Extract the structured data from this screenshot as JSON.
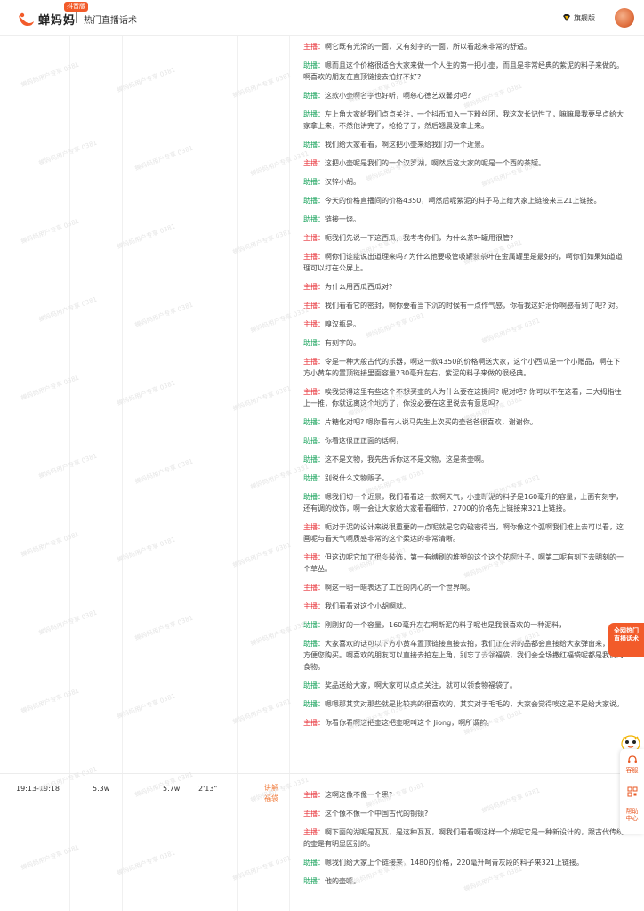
{
  "header": {
    "brand": "蝉妈妈",
    "version_badge": "抖音版",
    "page_title": "热门直播话术",
    "account_label": "旗舰版"
  },
  "colors": {
    "brand": "#f25b2a",
    "host_role": "#e8333a",
    "assistant_role": "#19a35c",
    "type_tag": "#f07a3a"
  },
  "watermark_text": "蝉妈妈用户专享 0381",
  "row_second": {
    "time_range": "19:13-19:18",
    "metric_a": "5.3w",
    "metric_b": "5.7w",
    "duration": "2'13\"",
    "type": "讲解\n福袋"
  },
  "lines_first": [
    {
      "role": "主播：",
      "kind": "host",
      "text": "啊它既有光滑的一面，又有刻字的一面，所以看起来非常的舒适。"
    },
    {
      "role": "助播：",
      "kind": "assist",
      "text": "嗯而且这个价格很适合大家来做一个人生的第一把小壶，而且是非常经典的紫泥的料子来做的。啊喜欢的朋友在直顶链接去拍好不好?"
    },
    {
      "role": "助播：",
      "kind": "assist",
      "text": "这款小壶啊名字也好听，啊慈心德艺双馨对吧?"
    },
    {
      "role": "助播：",
      "kind": "assist",
      "text": "左上角大家给我们点点关注，一个抖币加入一下粉丝团，我这次长记性了，嘛嘛晨我要早点给大家拿上来，不然他讲完了，抢抢了了，然后翘晨没拿上来。"
    },
    {
      "role": "助播：",
      "kind": "assist",
      "text": "我们给大家看看，啊这把小壶来给我们切一个近景。"
    },
    {
      "role": "主播：",
      "kind": "host",
      "text": "这把小壶呢是我们的一个汉罗湖，啊然后这大家的呢是一个西的茶罐。"
    },
    {
      "role": "助播：",
      "kind": "assist",
      "text": "汉锌小胡。"
    },
    {
      "role": "助播：",
      "kind": "assist",
      "text": "今天的价格直播间的价格4350，啊然后呢紫泥的料子马上给大家上链接来三21上链接。"
    },
    {
      "role": "助播：",
      "kind": "assist",
      "text": "链接一烧。"
    },
    {
      "role": "主播：",
      "kind": "host",
      "text": "呃我们先说一下这西瓜，我考考你们，为什么茶叶罐用很管?"
    },
    {
      "role": "主播：",
      "kind": "host",
      "text": "啊你们谁能说出道理来吗? 为什么他要吸管吸罐装茶叶在金属罐里是最好的，啊你们如果知道道理可以打在公屏上。"
    },
    {
      "role": "主播：",
      "kind": "host",
      "text": "为什么用西瓜西瓜对?"
    },
    {
      "role": "主播：",
      "kind": "host",
      "text": "我们看看它的密封，啊你要看当下沉的时候有一点作气感，你看我这好治你啊感看到了吧? 对。"
    },
    {
      "role": "主播：",
      "kind": "host",
      "text": "嗅汉瓶是。"
    },
    {
      "role": "助播：",
      "kind": "assist",
      "text": "有刻字的。"
    },
    {
      "role": "主播：",
      "kind": "host",
      "text": "令是一种大般古代的乐器，啊这一款4350的价格啊送大家，这个小西瓜是一个小赠品，啊在下方小黄车的置顶链接里面容量230毫升左右，紫泥的料子来做的很经典。"
    },
    {
      "role": "主播：",
      "kind": "host",
      "text": "唉我觉得这里有些这个不想买壶的人为什么要在这提问? 呢对吧? 你可以不在这看，二大拇指往上一推，你就远离这个地方了，你没必要在这里说去有意思吗?"
    },
    {
      "role": "助播：",
      "kind": "assist",
      "text": "片糖化对吧? 嗯你看有人说马先生上次买的壶爸爸很喜欢，谢谢你。"
    },
    {
      "role": "助播：",
      "kind": "assist",
      "text": "你看这很正正面的话啊，"
    },
    {
      "role": "助播：",
      "kind": "assist",
      "text": "这不是文物，我先告诉你这不是文物，这是茶壶啊。"
    },
    {
      "role": "助播：",
      "kind": "assist",
      "text": "别说什么文物贩子。"
    },
    {
      "role": "助播：",
      "kind": "assist",
      "text": "嗯我们切一个近景，我们看看这一款啊天气，小壶断泥的料子是160毫升的容量，上面有刻字，还有调的纹饰，啊一会让大家给大家看看细节，2700的价格先上链接来321上链接。"
    },
    {
      "role": "主播：",
      "kind": "host",
      "text": "呃对于泥的设计来说很重要的一点呢就是它的硫密得当，啊你像这个弧啊我们推上去可以看，这画呢与看天气啊质感非常的这个柔达的非常清晰。"
    },
    {
      "role": "主播：",
      "kind": "host",
      "text": "但这边呢它加了很多装饰，第一有缚刷的堆塑的这个这个花啊叶子，啊第二呢有刻下去明刻的一个草丛。"
    },
    {
      "role": "主播：",
      "kind": "host",
      "text": "啊这一明一暗表达了工匠的内心的一个世界啊。"
    },
    {
      "role": "主播：",
      "kind": "host",
      "text": "我们看看对这个小胡啊就。"
    },
    {
      "role": "助播：",
      "kind": "assist",
      "text": "刚刚好的一个容量，160毫升左右啊断泥的料子呢也是我很喜欢的一种泥料，"
    },
    {
      "role": "助播：",
      "kind": "assist",
      "text": "大家喜欢的话可以下方小黄车置顶链接直接去拍，我们正在讲的品都会直接给大家弹窗来，这样方便您购买。啊喜欢的朋友可以直接去拍左上角，别忘了去领福袋，我们会全场撒红福袋呢都是我们的食物。"
    },
    {
      "role": "助播：",
      "kind": "assist",
      "text": "奖品送给大家，啊大家可以点点关注，就可以领食物福袋了。"
    },
    {
      "role": "助播：",
      "kind": "assist",
      "text": "嗯嗯那其实对那些就是比较亮的很喜欢的，其实对于毛毛的，大家会觉得唉这是不是给大家说。"
    },
    {
      "role": "主播：",
      "kind": "host",
      "text": "你看你看啊这把壶这把壶呢叫这个 Jiong，啊所谓韵。"
    }
  ],
  "lines_second": [
    {
      "role": "主播：",
      "kind": "host",
      "text": "这啊这像不像一个患?"
    },
    {
      "role": "主播：",
      "kind": "host",
      "text": "这个像不像一个中国古代的铜镜?"
    },
    {
      "role": "主播：",
      "kind": "host",
      "text": "啊下面的湖呢是瓦瓦，是这种瓦瓦，啊我们看看啊这样一个湖呢它是一种新设计的，跟古代传统的壶是有明显区别的。"
    },
    {
      "role": "助播：",
      "kind": "assist",
      "text": "嗯我们给大家上个链接来，1480的价格，220毫升啊青灰段的料子来321上链接。"
    },
    {
      "role": "助播：",
      "kind": "assist",
      "text": "他的壶嘴。"
    }
  ],
  "side": {
    "promo": "全网热门\n直播话术",
    "feedback_label": "客服",
    "qr_label": "",
    "help_label": "帮助\n中心"
  }
}
